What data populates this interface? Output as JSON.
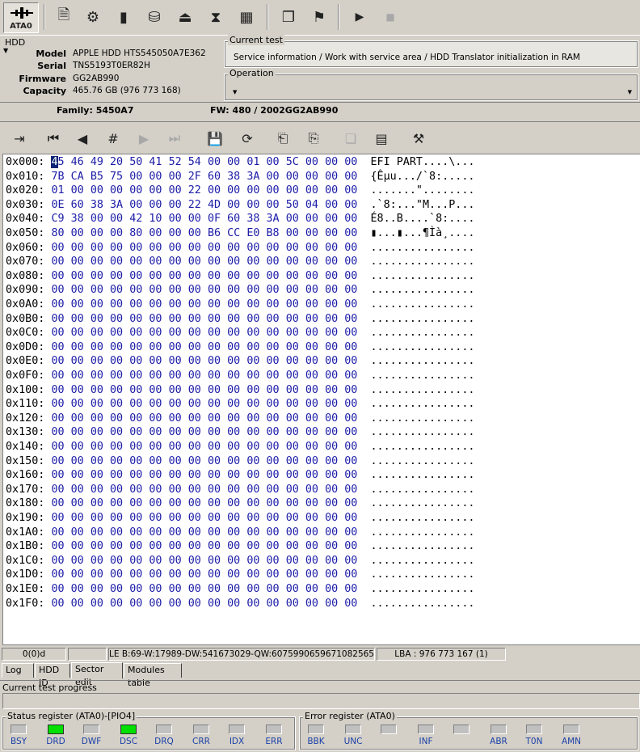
{
  "toolbar": {
    "ata_label": "ATA0"
  },
  "hdd": {
    "legend": "HDD",
    "model_label": "Model",
    "model": "APPLE HDD HTS545050A7E362",
    "serial_label": "Serial",
    "serial": "TNS5193T0ER82H",
    "firmware_label": "Firmware",
    "firmware": "GG2AB990",
    "capacity_label": "Capacity",
    "capacity": "465.76 GB (976 773 168)"
  },
  "current_test": {
    "legend": "Current test",
    "text": "Service information / Work with service area / HDD Translator initialization in RAM"
  },
  "operation": {
    "legend": "Operation",
    "value": ""
  },
  "family": {
    "family_text": "Family: 5450A7",
    "fw_text": "FW:  480 / 2002GG2AB990"
  },
  "hex": {
    "rows": [
      {
        "addr": "0x000:",
        "bytes": [
          "45",
          "46",
          "49",
          "20",
          "50",
          "41",
          "52",
          "54",
          "00",
          "00",
          "01",
          "00",
          "5C",
          "00",
          "00",
          "00"
        ],
        "ascii": "EFI PART....\\..."
      },
      {
        "addr": "0x010:",
        "bytes": [
          "7B",
          "CA",
          "B5",
          "75",
          "00",
          "00",
          "00",
          "2F",
          "60",
          "38",
          "3A",
          "00",
          "00",
          "00",
          "00",
          "00"
        ],
        "ascii": "{Êµu.../`8:....."
      },
      {
        "addr": "0x020:",
        "bytes": [
          "01",
          "00",
          "00",
          "00",
          "00",
          "00",
          "00",
          "22",
          "00",
          "00",
          "00",
          "00",
          "00",
          "00",
          "00",
          "00"
        ],
        "ascii": ".......\"........"
      },
      {
        "addr": "0x030:",
        "bytes": [
          "0E",
          "60",
          "38",
          "3A",
          "00",
          "00",
          "00",
          "22",
          "4D",
          "00",
          "00",
          "00",
          "50",
          "04",
          "00",
          "00"
        ],
        "ascii": ".`8:...\"M...P..."
      },
      {
        "addr": "0x040:",
        "bytes": [
          "C9",
          "38",
          "00",
          "00",
          "42",
          "10",
          "00",
          "00",
          "0F",
          "60",
          "38",
          "3A",
          "00",
          "00",
          "00",
          "00"
        ],
        "ascii": "É8..B....`8:...."
      },
      {
        "addr": "0x050:",
        "bytes": [
          "80",
          "00",
          "00",
          "00",
          "80",
          "00",
          "00",
          "00",
          "B6",
          "CC",
          "E0",
          "B8",
          "00",
          "00",
          "00",
          "00"
        ],
        "ascii": "▮...▮...¶Ìà¸...."
      },
      {
        "addr": "0x060:",
        "bytes": [
          "00",
          "00",
          "00",
          "00",
          "00",
          "00",
          "00",
          "00",
          "00",
          "00",
          "00",
          "00",
          "00",
          "00",
          "00",
          "00"
        ],
        "ascii": "................"
      },
      {
        "addr": "0x070:",
        "bytes": [
          "00",
          "00",
          "00",
          "00",
          "00",
          "00",
          "00",
          "00",
          "00",
          "00",
          "00",
          "00",
          "00",
          "00",
          "00",
          "00"
        ],
        "ascii": "................"
      },
      {
        "addr": "0x080:",
        "bytes": [
          "00",
          "00",
          "00",
          "00",
          "00",
          "00",
          "00",
          "00",
          "00",
          "00",
          "00",
          "00",
          "00",
          "00",
          "00",
          "00"
        ],
        "ascii": "................"
      },
      {
        "addr": "0x090:",
        "bytes": [
          "00",
          "00",
          "00",
          "00",
          "00",
          "00",
          "00",
          "00",
          "00",
          "00",
          "00",
          "00",
          "00",
          "00",
          "00",
          "00"
        ],
        "ascii": "................"
      },
      {
        "addr": "0x0A0:",
        "bytes": [
          "00",
          "00",
          "00",
          "00",
          "00",
          "00",
          "00",
          "00",
          "00",
          "00",
          "00",
          "00",
          "00",
          "00",
          "00",
          "00"
        ],
        "ascii": "................"
      },
      {
        "addr": "0x0B0:",
        "bytes": [
          "00",
          "00",
          "00",
          "00",
          "00",
          "00",
          "00",
          "00",
          "00",
          "00",
          "00",
          "00",
          "00",
          "00",
          "00",
          "00"
        ],
        "ascii": "................"
      },
      {
        "addr": "0x0C0:",
        "bytes": [
          "00",
          "00",
          "00",
          "00",
          "00",
          "00",
          "00",
          "00",
          "00",
          "00",
          "00",
          "00",
          "00",
          "00",
          "00",
          "00"
        ],
        "ascii": "................"
      },
      {
        "addr": "0x0D0:",
        "bytes": [
          "00",
          "00",
          "00",
          "00",
          "00",
          "00",
          "00",
          "00",
          "00",
          "00",
          "00",
          "00",
          "00",
          "00",
          "00",
          "00"
        ],
        "ascii": "................"
      },
      {
        "addr": "0x0E0:",
        "bytes": [
          "00",
          "00",
          "00",
          "00",
          "00",
          "00",
          "00",
          "00",
          "00",
          "00",
          "00",
          "00",
          "00",
          "00",
          "00",
          "00"
        ],
        "ascii": "................"
      },
      {
        "addr": "0x0F0:",
        "bytes": [
          "00",
          "00",
          "00",
          "00",
          "00",
          "00",
          "00",
          "00",
          "00",
          "00",
          "00",
          "00",
          "00",
          "00",
          "00",
          "00"
        ],
        "ascii": "................"
      },
      {
        "addr": "0x100:",
        "bytes": [
          "00",
          "00",
          "00",
          "00",
          "00",
          "00",
          "00",
          "00",
          "00",
          "00",
          "00",
          "00",
          "00",
          "00",
          "00",
          "00"
        ],
        "ascii": "................"
      },
      {
        "addr": "0x110:",
        "bytes": [
          "00",
          "00",
          "00",
          "00",
          "00",
          "00",
          "00",
          "00",
          "00",
          "00",
          "00",
          "00",
          "00",
          "00",
          "00",
          "00"
        ],
        "ascii": "................"
      },
      {
        "addr": "0x120:",
        "bytes": [
          "00",
          "00",
          "00",
          "00",
          "00",
          "00",
          "00",
          "00",
          "00",
          "00",
          "00",
          "00",
          "00",
          "00",
          "00",
          "00"
        ],
        "ascii": "................"
      },
      {
        "addr": "0x130:",
        "bytes": [
          "00",
          "00",
          "00",
          "00",
          "00",
          "00",
          "00",
          "00",
          "00",
          "00",
          "00",
          "00",
          "00",
          "00",
          "00",
          "00"
        ],
        "ascii": "................"
      },
      {
        "addr": "0x140:",
        "bytes": [
          "00",
          "00",
          "00",
          "00",
          "00",
          "00",
          "00",
          "00",
          "00",
          "00",
          "00",
          "00",
          "00",
          "00",
          "00",
          "00"
        ],
        "ascii": "................"
      },
      {
        "addr": "0x150:",
        "bytes": [
          "00",
          "00",
          "00",
          "00",
          "00",
          "00",
          "00",
          "00",
          "00",
          "00",
          "00",
          "00",
          "00",
          "00",
          "00",
          "00"
        ],
        "ascii": "................"
      },
      {
        "addr": "0x160:",
        "bytes": [
          "00",
          "00",
          "00",
          "00",
          "00",
          "00",
          "00",
          "00",
          "00",
          "00",
          "00",
          "00",
          "00",
          "00",
          "00",
          "00"
        ],
        "ascii": "................"
      },
      {
        "addr": "0x170:",
        "bytes": [
          "00",
          "00",
          "00",
          "00",
          "00",
          "00",
          "00",
          "00",
          "00",
          "00",
          "00",
          "00",
          "00",
          "00",
          "00",
          "00"
        ],
        "ascii": "................"
      },
      {
        "addr": "0x180:",
        "bytes": [
          "00",
          "00",
          "00",
          "00",
          "00",
          "00",
          "00",
          "00",
          "00",
          "00",
          "00",
          "00",
          "00",
          "00",
          "00",
          "00"
        ],
        "ascii": "................"
      },
      {
        "addr": "0x190:",
        "bytes": [
          "00",
          "00",
          "00",
          "00",
          "00",
          "00",
          "00",
          "00",
          "00",
          "00",
          "00",
          "00",
          "00",
          "00",
          "00",
          "00"
        ],
        "ascii": "................"
      },
      {
        "addr": "0x1A0:",
        "bytes": [
          "00",
          "00",
          "00",
          "00",
          "00",
          "00",
          "00",
          "00",
          "00",
          "00",
          "00",
          "00",
          "00",
          "00",
          "00",
          "00"
        ],
        "ascii": "................"
      },
      {
        "addr": "0x1B0:",
        "bytes": [
          "00",
          "00",
          "00",
          "00",
          "00",
          "00",
          "00",
          "00",
          "00",
          "00",
          "00",
          "00",
          "00",
          "00",
          "00",
          "00"
        ],
        "ascii": "................"
      },
      {
        "addr": "0x1C0:",
        "bytes": [
          "00",
          "00",
          "00",
          "00",
          "00",
          "00",
          "00",
          "00",
          "00",
          "00",
          "00",
          "00",
          "00",
          "00",
          "00",
          "00"
        ],
        "ascii": "................"
      },
      {
        "addr": "0x1D0:",
        "bytes": [
          "00",
          "00",
          "00",
          "00",
          "00",
          "00",
          "00",
          "00",
          "00",
          "00",
          "00",
          "00",
          "00",
          "00",
          "00",
          "00"
        ],
        "ascii": "................"
      },
      {
        "addr": "0x1E0:",
        "bytes": [
          "00",
          "00",
          "00",
          "00",
          "00",
          "00",
          "00",
          "00",
          "00",
          "00",
          "00",
          "00",
          "00",
          "00",
          "00",
          "00"
        ],
        "ascii": "................"
      },
      {
        "addr": "0x1F0:",
        "bytes": [
          "00",
          "00",
          "00",
          "00",
          "00",
          "00",
          "00",
          "00",
          "00",
          "00",
          "00",
          "00",
          "00",
          "00",
          "00",
          "00"
        ],
        "ascii": "................"
      }
    ]
  },
  "statusbar": {
    "position": "0(0)d",
    "blank": "",
    "le": "LE B:69-W:17989-DW:541673029-QW:6075990659671082565",
    "lba": "LBA : 976 773 167 (1)"
  },
  "tabs": [
    "Log",
    "HDD ID",
    "Sector edit",
    "Modules table"
  ],
  "progress": {
    "label": "Current test progress"
  },
  "status_register": {
    "legend": "Status register (ATA0)-[PIO4]",
    "leds": [
      {
        "label": "BSY",
        "on": false
      },
      {
        "label": "DRD",
        "on": true
      },
      {
        "label": "DWF",
        "on": false
      },
      {
        "label": "DSC",
        "on": true
      },
      {
        "label": "DRQ",
        "on": false
      },
      {
        "label": "CRR",
        "on": false
      },
      {
        "label": "IDX",
        "on": false
      },
      {
        "label": "ERR",
        "on": false
      }
    ]
  },
  "error_register": {
    "legend": "Error register (ATA0)",
    "leds": [
      {
        "label": "BBK",
        "on": false
      },
      {
        "label": "UNC",
        "on": false
      },
      {
        "label": "",
        "on": false
      },
      {
        "label": "INF",
        "on": false
      },
      {
        "label": "",
        "on": false
      },
      {
        "label": "ABR",
        "on": false
      },
      {
        "label": "T0N",
        "on": false
      },
      {
        "label": "AMN",
        "on": false
      }
    ]
  },
  "colors": {
    "hex_bytes": "#1c1ca8",
    "selection": "#0a2473",
    "led_on": "#00e000",
    "led_label": "#1a3fa8"
  }
}
